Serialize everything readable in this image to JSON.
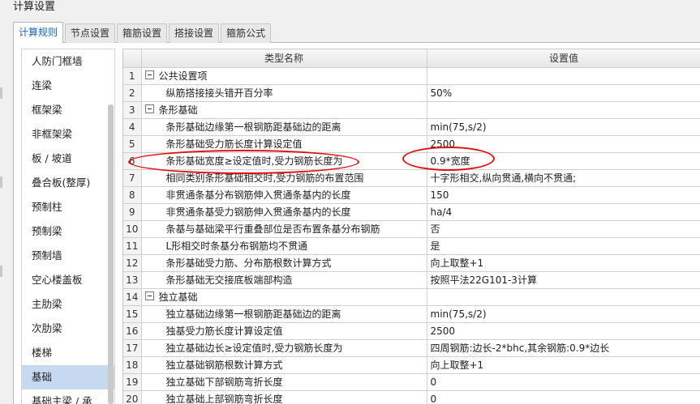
{
  "window": {
    "title": "计算设置"
  },
  "tabs": [
    {
      "label": "计算规则",
      "active": true
    },
    {
      "label": "节点设置",
      "active": false
    },
    {
      "label": "箍筋设置",
      "active": false
    },
    {
      "label": "搭接设置",
      "active": false
    },
    {
      "label": "箍筋公式",
      "active": false
    }
  ],
  "sidebar": {
    "items": [
      {
        "label": "人防门框墙"
      },
      {
        "label": "连梁"
      },
      {
        "label": "框架梁"
      },
      {
        "label": "非框架梁"
      },
      {
        "label": "板 / 坡道"
      },
      {
        "label": "叠合板(整厚)"
      },
      {
        "label": "预制柱"
      },
      {
        "label": "预制梁"
      },
      {
        "label": "预制墙"
      },
      {
        "label": "空心楼盖板"
      },
      {
        "label": "主肋梁"
      },
      {
        "label": "次肋梁"
      },
      {
        "label": "楼梯"
      },
      {
        "label": "基础",
        "selected": true
      },
      {
        "label": "基础主梁 / 承"
      }
    ]
  },
  "table": {
    "headers": {
      "name": "类型名称",
      "value": "设置值"
    },
    "rows": [
      {
        "num": "1",
        "name": "公共设置项",
        "value": "",
        "group": true
      },
      {
        "num": "2",
        "name": "纵筋搭接接头错开百分率",
        "value": "50%"
      },
      {
        "num": "3",
        "name": "条形基础",
        "value": "",
        "group": true
      },
      {
        "num": "4",
        "name": "条形基础边缘第一根钢筋距基础边的距离",
        "value": "min(75,s/2)"
      },
      {
        "num": "5",
        "name": "条形基础受力筋长度计算设定值",
        "value": "2500"
      },
      {
        "num": "6",
        "name": "条形基础宽度≥设定值时,受力钢筋长度为",
        "value": "0.9*宽度"
      },
      {
        "num": "7",
        "name": "相同类别条形基础相交时,受力钢筋的布置范围",
        "value": "十字形相交,纵向贯通,横向不贯通;"
      },
      {
        "num": "8",
        "name": "非贯通条基分布钢筋伸入贯通条基内的长度",
        "value": "150"
      },
      {
        "num": "9",
        "name": "非贯通条基受力钢筋伸入贯通条基内的长度",
        "value": "ha/4"
      },
      {
        "num": "10",
        "name": "条基与基础梁平行重叠部位是否布置条基分布钢筋",
        "value": "否"
      },
      {
        "num": "11",
        "name": "L形相交时条基分布钢筋均不贯通",
        "value": "是"
      },
      {
        "num": "12",
        "name": "条形基础受力筋、分布筋根数计算方式",
        "value": "向上取整+1"
      },
      {
        "num": "13",
        "name": "条形基础无交接底板端部构造",
        "value": "按照平法22G101-3计算"
      },
      {
        "num": "14",
        "name": "独立基础",
        "value": "",
        "group": true
      },
      {
        "num": "15",
        "name": "独立基础边缘第一根钢筋距基础边的距离",
        "value": "min(75,s/2)"
      },
      {
        "num": "16",
        "name": "独基受力筋长度计算设定值",
        "value": "2500"
      },
      {
        "num": "17",
        "name": "独立基础边长≥设定值时,受力钢筋长度为",
        "value": "四周钢筋:边长-2*bhc,其余钢筋:0.9*边长"
      },
      {
        "num": "18",
        "name": "独立基础钢筋根数计算方式",
        "value": "向上取整+1"
      },
      {
        "num": "19",
        "name": "独立基础下部钢筋弯折长度",
        "value": "0"
      },
      {
        "num": "20",
        "name": "独立基础上部钢筋弯折长度",
        "value": "0"
      }
    ]
  },
  "annotation": {
    "color": "#e01010"
  }
}
